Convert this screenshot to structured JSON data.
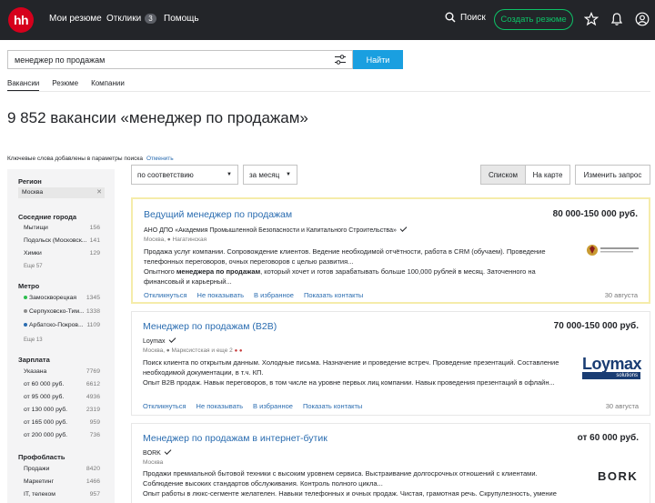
{
  "header": {
    "logo": "hh",
    "nav": [
      {
        "label": "Мои резюме"
      },
      {
        "label": "Отклики",
        "badge": "3"
      },
      {
        "label": "Помощь"
      }
    ],
    "search_label": "Поиск",
    "create_resume": "Создать резюме"
  },
  "search": {
    "value": "менеджер по продажам",
    "button": "Найти"
  },
  "tabs": [
    "Вакансии",
    "Резюме",
    "Компании"
  ],
  "title": "9 852 вакансии «менеджер по продажам»",
  "keywords_note": "Ключевые слова добавлены в параметры поиска",
  "keywords_cancel": "Отменить",
  "sort": {
    "order": "по соответствию",
    "period": "за месяц",
    "view_list": "Списком",
    "view_map": "На карте",
    "change_query": "Изменить запрос"
  },
  "sidebar": {
    "region_head": "Регион",
    "region_value": "Москва",
    "cities_head": "Соседние города",
    "cities": [
      {
        "label": "Мытищи",
        "count": "156"
      },
      {
        "label": "Подольск (Московск...",
        "count": "141"
      },
      {
        "label": "Химки",
        "count": "129"
      }
    ],
    "cities_more": "Еще 57",
    "metro_head": "Метро",
    "metro": [
      {
        "label": "Замоскворецкая",
        "count": "1345",
        "color": "#2dbd4e"
      },
      {
        "label": "Серпуховско-Тим...",
        "count": "1338",
        "color": "#8d8d8d"
      },
      {
        "label": "Арбатско-Покров...",
        "count": "1109",
        "color": "#2a6cb0"
      }
    ],
    "metro_more": "Еще 13",
    "salary_head": "Зарплата",
    "salary": [
      {
        "label": "Указана",
        "count": "7769"
      },
      {
        "label": "от 60 000 руб.",
        "count": "6612"
      },
      {
        "label": "от 95 000 руб.",
        "count": "4936"
      },
      {
        "label": "от 130 000 руб.",
        "count": "2319"
      },
      {
        "label": "от 165 000 руб.",
        "count": "959"
      },
      {
        "label": "от 200 000 руб.",
        "count": "736"
      }
    ],
    "prof_head": "Профобласть",
    "prof": [
      {
        "label": "Продажи",
        "count": "8420"
      },
      {
        "label": "Маркетинг",
        "count": "1466"
      },
      {
        "label": "IT, телеком",
        "count": "957"
      }
    ]
  },
  "vacancies": [
    {
      "title": "Ведущий менеджер по продажам",
      "salary": "80 000-150 000 руб.",
      "company": "АНО ДПО «Академия Промышленной Безопасности и Капитального Строительства»",
      "location": "Москва, ● Нагатинская",
      "desc1": "Продажа услуг компании. Сопровождение клиентов. Ведение необходимой отчётности, работа в CRM (обучаем). Проведение телефонных переговоров, очных переговоров с целью развития...",
      "desc2_pre": "Опытного ",
      "desc2_bold": "менеджера по продажам",
      "desc2_post": ", который хочет и готов зарабатывать больше 100,000 рублей в месяц. Заточенного на финансовый и карьерный...",
      "date": "30 августа"
    },
    {
      "title": "Менеджер по продажам (B2B)",
      "salary": "70 000-150 000 руб.",
      "company": "Loymax",
      "location": "Москва, ● Марксистская и еще 2",
      "desc1": "Поиск клиента по открытым данным. Холодные письма. Назначение и проведение встреч. Проведение презентаций. Составление необходимой документации, в т.ч. КП.",
      "desc2": "Опыт B2B продаж. Навык переговоров, в том числе на уровне первых лиц компании. Навык проведения презентаций в офлайн...",
      "date": "30 августа",
      "logo_main": "Loymax",
      "logo_sub": "solutions"
    },
    {
      "title": "Менеджер по продажам в интернет-бутик",
      "salary": "от 60 000 руб.",
      "company": "BORK",
      "location": "Москва",
      "desc1": "Продажи премиальной бытовой техники с высоким уровнем сервиса. Выстраивание долгосрочных отношений с клиентами. Соблюдение высоких стандартов обслуживания. Контроль полного цикла...",
      "desc2": "Опыт работы в люкс-сегменте желателен. Навыки телефонных и очных продаж. Чистая, грамотная речь. Скрупулезность, умение",
      "logo": "BORK"
    }
  ],
  "actions": [
    "Откликнуться",
    "Не показывать",
    "В избранное",
    "Показать контакты"
  ],
  "colors": {
    "brand": "#d6001c",
    "link": "#2a6cb0",
    "accent": "#0dc267",
    "button": "#1a9fe0"
  }
}
